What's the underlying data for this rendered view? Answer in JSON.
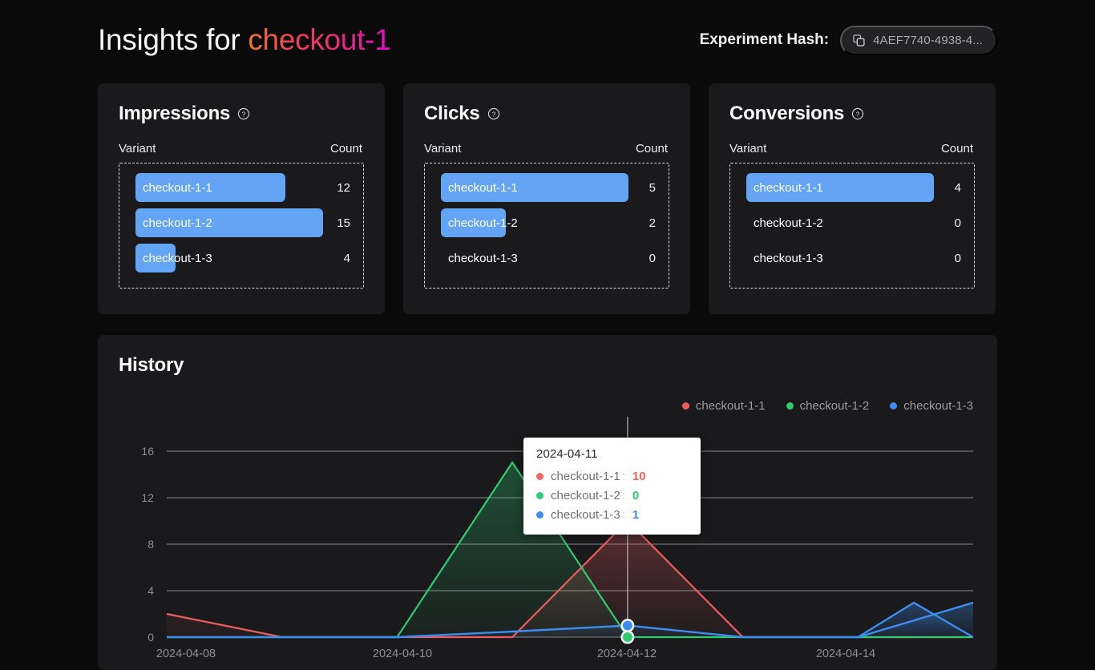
{
  "header": {
    "title_prefix": "Insights for ",
    "experiment_name": "checkout-1",
    "hash_label": "Experiment Hash:",
    "hash_value": "4AEF7740-4938-4...",
    "copy_icon": "copy-icon"
  },
  "cards": [
    {
      "title": "Impressions",
      "help_icon": "question-circle-icon",
      "col_variant": "Variant",
      "col_count": "Count",
      "rows": [
        {
          "variant": "checkout-1-1",
          "count": "12",
          "pct": 80
        },
        {
          "variant": "checkout-1-2",
          "count": "15",
          "pct": 100
        },
        {
          "variant": "checkout-1-3",
          "count": "4",
          "pct": 26.7
        }
      ]
    },
    {
      "title": "Clicks",
      "help_icon": "question-circle-icon",
      "col_variant": "Variant",
      "col_count": "Count",
      "rows": [
        {
          "variant": "checkout-1-1",
          "count": "5",
          "pct": 100
        },
        {
          "variant": "checkout-1-2",
          "count": "2",
          "pct": 40
        },
        {
          "variant": "checkout-1-3",
          "count": "0",
          "pct": 0
        }
      ]
    },
    {
      "title": "Conversions",
      "help_icon": "question-circle-icon",
      "col_variant": "Variant",
      "col_count": "Count",
      "rows": [
        {
          "variant": "checkout-1-1",
          "count": "4",
          "pct": 100
        },
        {
          "variant": "checkout-1-2",
          "count": "0",
          "pct": 0
        },
        {
          "variant": "checkout-1-3",
          "count": "0",
          "pct": 0
        }
      ]
    }
  ],
  "history": {
    "title": "History",
    "legend": [
      {
        "label": "checkout-1-1",
        "color": "#ee5d5d"
      },
      {
        "label": "checkout-1-2",
        "color": "#2ecc6f"
      },
      {
        "label": "checkout-1-3",
        "color": "#3b8ef0"
      }
    ]
  },
  "tooltip": {
    "date": "2024-04-11",
    "colon": ":",
    "rows": [
      {
        "name": "checkout-1-1",
        "value": "10",
        "color": "#f2645f"
      },
      {
        "name": "checkout-1-2",
        "value": "0",
        "color": "#2ecc6f"
      },
      {
        "name": "checkout-1-3",
        "value": "1",
        "color": "#3b8ef0"
      }
    ]
  },
  "chart_data": {
    "type": "line",
    "title": "History",
    "xlabel": "",
    "ylabel": "",
    "x": [
      "2024-04-08",
      "2024-04-09",
      "2024-04-10",
      "2024-04-11",
      "2024-04-12",
      "2024-04-13",
      "2024-04-14",
      "2024-04-15"
    ],
    "x_tick_labels": [
      "2024-04-08",
      "2024-04-10",
      "2024-04-12",
      "2024-04-14"
    ],
    "y_ticks": [
      0,
      4,
      8,
      12,
      16
    ],
    "ylim": [
      0,
      17
    ],
    "grid": true,
    "legend_position": "top-right",
    "area_fill": true,
    "series": [
      {
        "name": "checkout-1-1",
        "color": "#ee5d5d",
        "values": [
          2,
          0,
          0,
          10,
          0,
          0,
          0,
          0
        ]
      },
      {
        "name": "checkout-1-2",
        "color": "#2ecc6f",
        "values": [
          0,
          0,
          15,
          0,
          0,
          0,
          0,
          0
        ]
      },
      {
        "name": "checkout-1-3",
        "color": "#3b8ef0",
        "values": [
          0,
          0,
          0,
          1,
          0,
          0,
          3,
          0
        ]
      }
    ],
    "hover": {
      "x": "2024-04-11",
      "points": [
        {
          "name": "checkout-1-1",
          "value": 10
        },
        {
          "name": "checkout-1-2",
          "value": 0
        },
        {
          "name": "checkout-1-3",
          "value": 1
        }
      ]
    }
  }
}
